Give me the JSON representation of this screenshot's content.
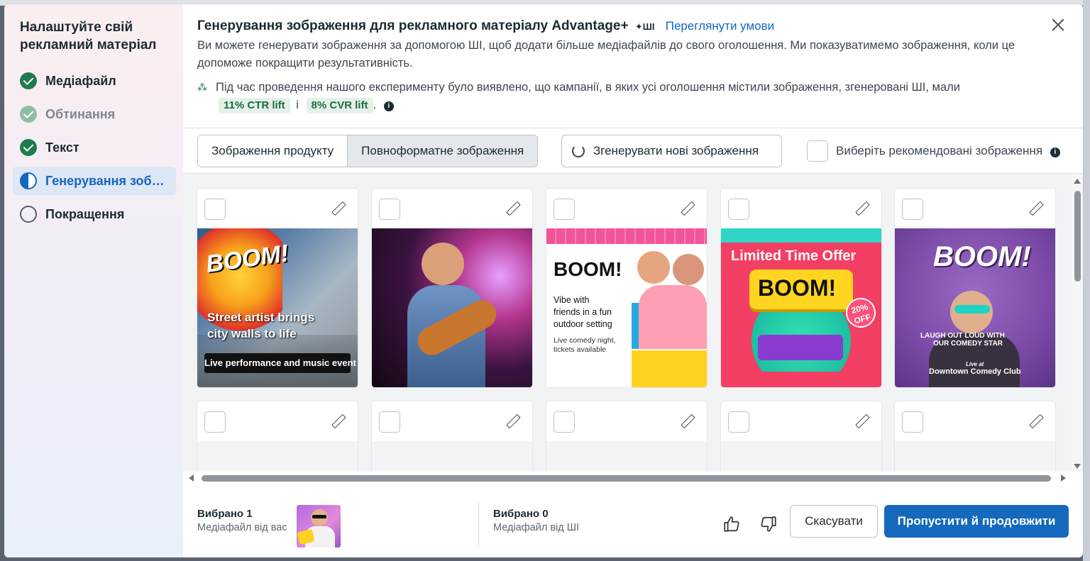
{
  "sidebar": {
    "title": "Налаштуйте свій рекламний матеріал",
    "steps": [
      {
        "label": "Медіафайл",
        "state": "done"
      },
      {
        "label": "Обтинання",
        "state": "done-faded"
      },
      {
        "label": "Текст",
        "state": "done"
      },
      {
        "label": "Генерування зоб…",
        "state": "active"
      },
      {
        "label": "Покращення",
        "state": "pending"
      }
    ]
  },
  "header": {
    "title": "Генерування зображення для рекламного матеріалу Advantage+",
    "ai_mark": "ШІ",
    "terms_link": "Переглянути умови",
    "description": "Ви можете генерувати зображення за допомогою ШІ, щоб додати більше медіафайлів до свого оголошення. Ми показуватимемо зображення, коли це допоможе покращити результативність.",
    "experiment_text": "Під час проведення нашого експерименту було виявлено, що кампанії, в яких усі оголошення містили зображення, згенеровані ШІ, мали",
    "badge_ctr": "11% CTR lift",
    "conjunction": "і",
    "badge_cvr": "8% CVR lift",
    "period": "."
  },
  "toolbar": {
    "tabs": [
      "Зображення продукту",
      "Повноформатне зображення"
    ],
    "selected_tab": "Повноформатне зображення",
    "generate_label": "Згенерувати нові зображення",
    "recommended_label": "Виберіть рекомендовані зображення"
  },
  "images": [
    {
      "id": "street-art",
      "headline": "BOOM!",
      "line1": "Street artist brings",
      "line2": "city walls to life",
      "line3": "Live performance and music event"
    },
    {
      "id": "guitarist"
    },
    {
      "id": "friends",
      "headline": "BOOM!",
      "line1": "Vibe with",
      "line2": "friends in a fun",
      "line3": "outdoor setting",
      "line4": "Live comedy night,",
      "line5": "tickets available"
    },
    {
      "id": "limited-offer",
      "headline": "Limited Time Offer",
      "boom": "BOOM!",
      "badge1": "20%",
      "badge2": "OFF"
    },
    {
      "id": "comedy",
      "headline": "BOOM!",
      "line1": "LAUGH OUT LOUD WITH",
      "line2": "OUR COMEDY STAR",
      "line3": "Live at",
      "line4": "Downtown Comedy Club"
    }
  ],
  "footer": {
    "selected_own_title": "Вибрано 1",
    "selected_own_sub": "Медіафайл від вас",
    "selected_ai_title": "Вибрано 0",
    "selected_ai_sub": "Медіафайл від ШІ",
    "cancel_label": "Скасувати",
    "continue_label": "Пропустити й продовжити"
  },
  "colors": {
    "accent": "#1469bd",
    "success": "#1f7a4d",
    "badge_bg": "#e3f1e7"
  }
}
